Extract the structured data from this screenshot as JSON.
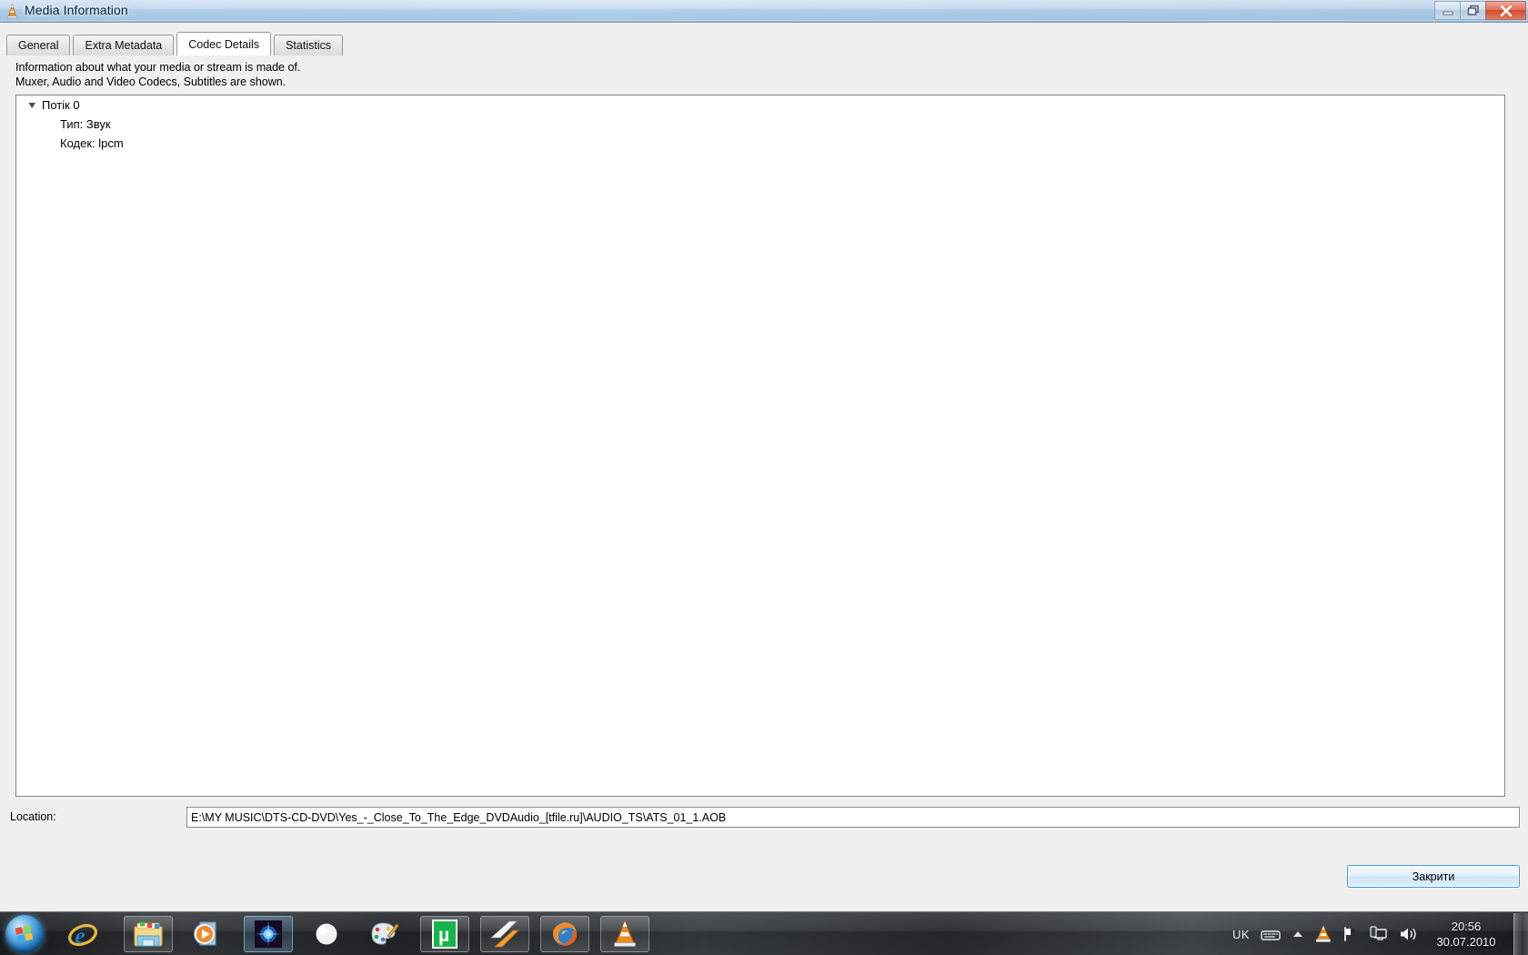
{
  "window": {
    "title": "Media Information",
    "icon": "vlc-cone-icon",
    "controls": {
      "minimize": "minimize-icon",
      "maximize": "restore-icon",
      "close": "close-icon"
    }
  },
  "tabs": [
    {
      "label": "General",
      "active": false
    },
    {
      "label": "Extra Metadata",
      "active": false
    },
    {
      "label": "Codec Details",
      "active": true
    },
    {
      "label": "Statistics",
      "active": false
    }
  ],
  "description": {
    "line1": "Information about what your media or stream is made of.",
    "line2": "Muxer, Audio and Video Codecs, Subtitles are shown."
  },
  "tree": {
    "root_label": "Потік 0",
    "children": [
      "Тип: Звук",
      "Кодек: lpcm"
    ]
  },
  "location": {
    "label": "Location:",
    "value": "E:\\MY MUSIC\\DTS-CD-DVD\\Yes_-_Close_To_The_Edge_DVDAudio_[tfile.ru]\\AUDIO_TS\\ATS_01_1.AOB"
  },
  "footer": {
    "close_label": "Закрити"
  },
  "taskbar": {
    "start": "windows-start-orb",
    "items": [
      {
        "name": "internet-explorer",
        "state": "normal"
      },
      {
        "name": "windows-explorer",
        "state": "pressed"
      },
      {
        "name": "windows-media-player",
        "state": "normal"
      },
      {
        "name": "blue-star-app",
        "state": "sel"
      },
      {
        "name": "white-sphere-app",
        "state": "normal"
      },
      {
        "name": "ms-paint",
        "state": "normal"
      },
      {
        "name": "utorrent",
        "state": "pressed"
      },
      {
        "name": "winamp",
        "state": "pressed"
      },
      {
        "name": "mozilla-firefox",
        "state": "pressed"
      },
      {
        "name": "vlc-media-player",
        "state": "pressed"
      }
    ],
    "tray": {
      "language": "UK",
      "icons": [
        "keyboard-icon",
        "show-hidden-icons-chevron",
        "vlc-cone-icon",
        "action-center-flag-icon",
        "network-monitor-icon",
        "volume-speaker-icon"
      ],
      "time": "20:56",
      "date": "30.07.2010"
    }
  },
  "colors": {
    "titlebar": "#a9c9e6",
    "accent_button_border": "#3c9ad4",
    "close_button_red": "#cf4b30",
    "window_bg": "#f0f0f0",
    "panel_bg": "#ffffff"
  }
}
